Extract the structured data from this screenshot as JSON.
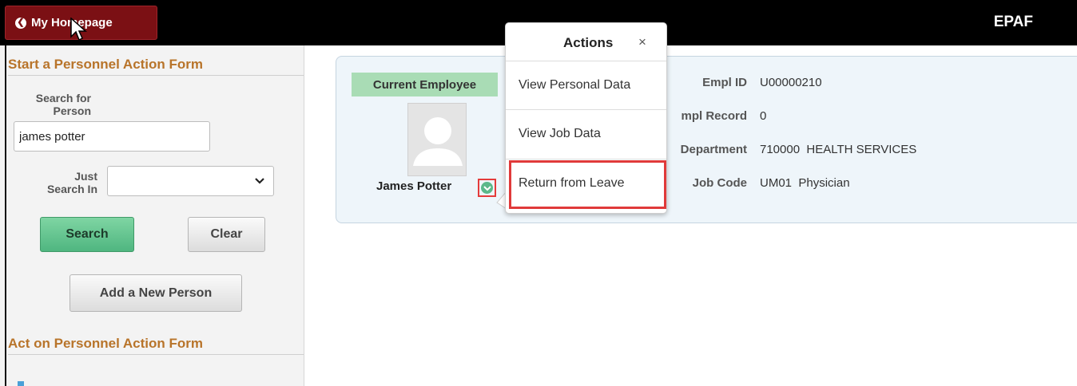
{
  "header": {
    "home_button_label": "My Homepage",
    "app_title": "EPAF"
  },
  "left_panel": {
    "start_section_title": "Start a Personnel Action Form",
    "search_for_label_line1": "Search for",
    "search_for_label_line2": "Person",
    "search_value": "james potter",
    "just_search_in_line1": "Just",
    "just_search_in_line2": "Search In",
    "just_search_in_value": "",
    "search_button": "Search",
    "clear_button": "Clear",
    "add_person_button": "Add a New Person",
    "act_section_title": "Act on Personnel Action Form"
  },
  "employee": {
    "badge": "Current Employee",
    "name": "James Potter",
    "fields": {
      "empl_id_label": "Empl ID",
      "empl_id_value": "U00000210",
      "empl_record_label": "mpl Record",
      "empl_record_value": "0",
      "department_label": "Department",
      "department_value": "710000  HEALTH SERVICES",
      "job_code_label": "Job Code",
      "job_code_value": "UM01  Physician"
    }
  },
  "actions_popup": {
    "title": "Actions",
    "close_glyph": "×",
    "items": [
      "View Personal Data",
      "View Job Data",
      "Return from Leave"
    ],
    "highlighted_item": "Return from Leave"
  },
  "colors": {
    "home_button": "#7b1014",
    "section_title": "#b8742a",
    "badge": "#a9dcb5",
    "search_button": "#4fb680",
    "highlight": "#e03a3a"
  }
}
